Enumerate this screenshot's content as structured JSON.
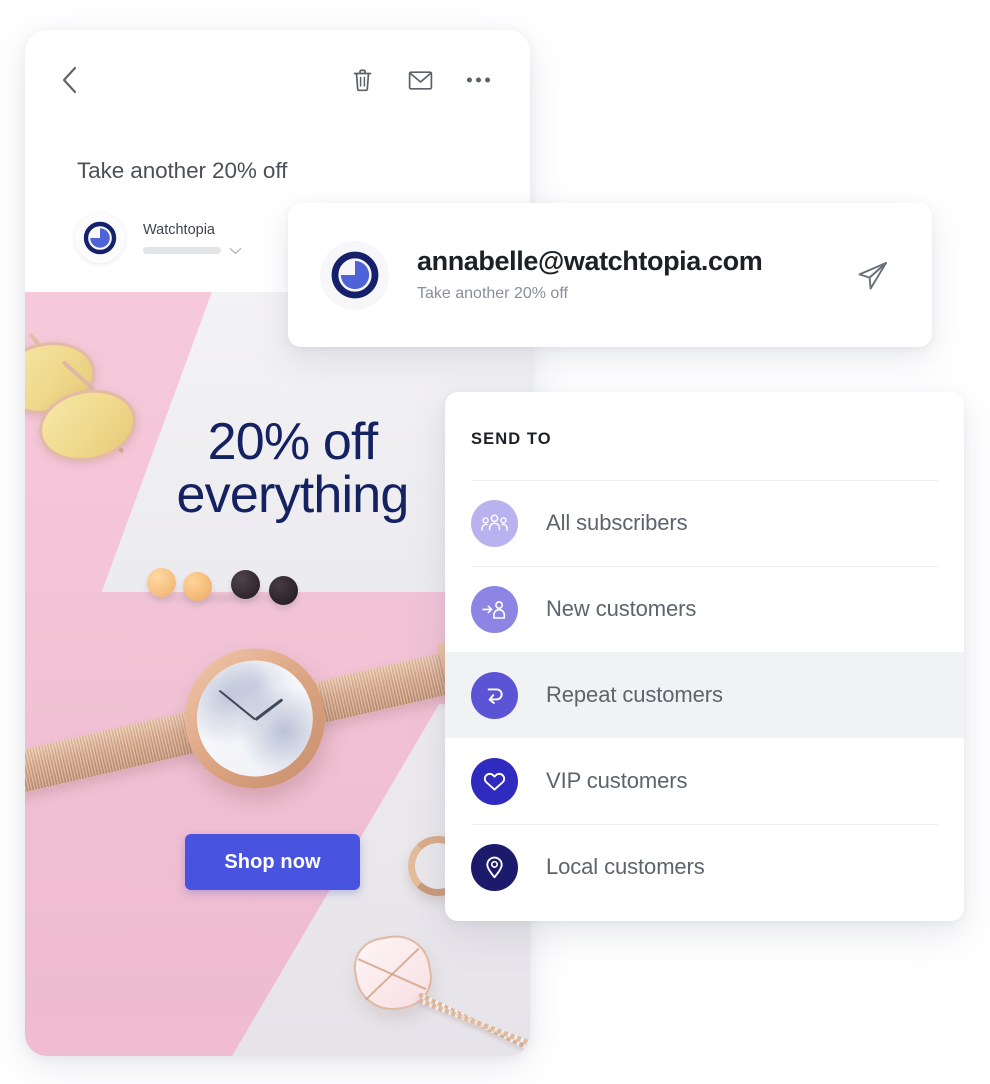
{
  "phone": {
    "toolbar": {
      "back_icon": "chevron-left-icon",
      "delete_icon": "trash-icon",
      "mail_icon": "envelope-icon",
      "more_icon": "ellipsis-icon"
    },
    "subject": "Take another 20% off",
    "sender": {
      "name": "Watchtopia",
      "logo_icon": "watchtopia-clock-logo",
      "expand_icon": "chevron-down-icon"
    },
    "creative": {
      "headline_line1": "20% off",
      "headline_line2": "everything",
      "cta_label": "Shop now",
      "headline_color": "#152261",
      "cta_bg": "#4853e0"
    }
  },
  "email_card": {
    "logo_icon": "watchtopia-clock-logo",
    "address": "annabelle@watchtopia.com",
    "subject": "Take another 20% off",
    "send_icon": "paper-plane-icon"
  },
  "send_to": {
    "title": "SEND TO",
    "items": [
      {
        "label": "All subscribers",
        "icon": "group-people-icon",
        "color": "#b9b2ee",
        "selected": false
      },
      {
        "label": "New customers",
        "icon": "person-arrow-in-icon",
        "color": "#8d85e3",
        "selected": false
      },
      {
        "label": "Repeat customers",
        "icon": "return-arrow-icon",
        "color": "#5b55d6",
        "selected": true
      },
      {
        "label": "VIP customers",
        "icon": "heart-icon",
        "color": "#2f2bbf",
        "selected": false
      },
      {
        "label": "Local customers",
        "icon": "map-pin-icon",
        "color": "#1b1a6b",
        "selected": false
      }
    ]
  }
}
